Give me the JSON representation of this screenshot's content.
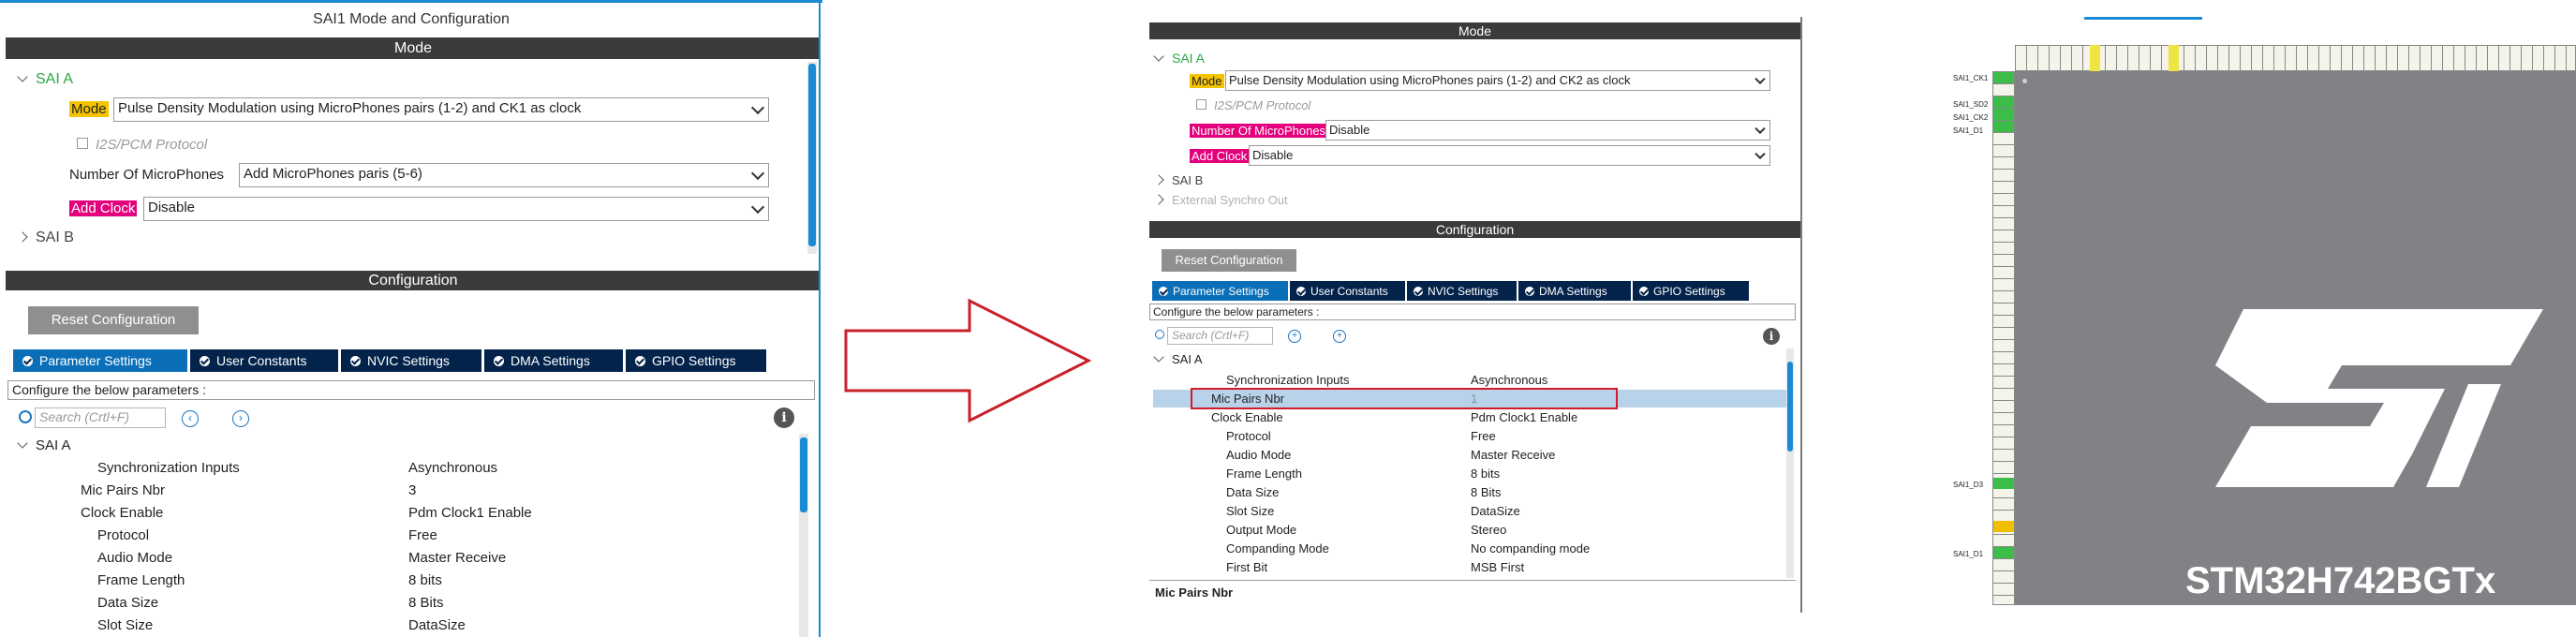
{
  "left": {
    "title": "SAI1 Mode and Configuration",
    "mode_header": "Mode",
    "sai_a_label": "SAI A",
    "mode_label": "Mode",
    "mode_value": "Pulse Density Modulation using MicroPhones pairs (1-2) and CK1 as clock",
    "i2s_protocol": "I2S/PCM Protocol",
    "num_mic_label": "Number Of MicroPhones",
    "num_mic_value": "Add MicroPhones paris (5-6)",
    "add_clock_label": "Add Clock",
    "add_clock_value": "Disable",
    "sai_b_label": "SAI B",
    "config_header": "Configuration",
    "reset_button": "Reset Configuration",
    "tabs": [
      "Parameter Settings",
      "User Constants",
      "NVIC Settings",
      "DMA Settings",
      "GPIO Settings"
    ],
    "configure_text": "Configure the below parameters :",
    "search_placeholder": "Search (Crtl+F)",
    "tree_sai_a": "SAI A",
    "params": [
      {
        "name": "Synchronization Inputs",
        "value": "Asynchronous"
      },
      {
        "name": "Mic Pairs Nbr",
        "value": "3"
      },
      {
        "name": "Clock Enable",
        "value": "Pdm Clock1 Enable"
      },
      {
        "name": "Protocol",
        "value": "Free"
      },
      {
        "name": "Audio Mode",
        "value": "Master Receive"
      },
      {
        "name": "Frame Length",
        "value": "8 bits"
      },
      {
        "name": "Data Size",
        "value": "8 Bits"
      },
      {
        "name": "Slot Size",
        "value": "DataSize"
      }
    ]
  },
  "mid": {
    "mode_header": "Mode",
    "sai_a_label": "SAI A",
    "mode_label": "Mode",
    "mode_value": "Pulse Density Modulation using MicroPhones pairs (1-2) and CK2 as clock",
    "i2s_protocol": "I2S/PCM Protocol",
    "num_mic_label": "Number Of MicroPhones",
    "num_mic_value": "Disable",
    "add_clock_label": "Add Clock",
    "add_clock_value": "Disable",
    "sai_b_label": "SAI B",
    "ext_sync_label": "External Synchro Out",
    "config_header": "Configuration",
    "reset_button": "Reset Configuration",
    "tabs": [
      "Parameter Settings",
      "User Constants",
      "NVIC Settings",
      "DMA Settings",
      "GPIO Settings"
    ],
    "configure_text": "Configure the below parameters :",
    "search_placeholder": "Search (Crtl+F)",
    "tree_sai_a": "SAI A",
    "params": [
      {
        "name": "Synchronization Inputs",
        "value": "Asynchronous"
      },
      {
        "name": "Mic Pairs Nbr",
        "value": "1"
      },
      {
        "name": "Clock Enable",
        "value": "Pdm Clock1 Enable"
      },
      {
        "name": "Protocol",
        "value": "Free"
      },
      {
        "name": "Audio Mode",
        "value": "Master Receive"
      },
      {
        "name": "Frame Length",
        "value": "8 bits"
      },
      {
        "name": "Data Size",
        "value": "8 Bits"
      },
      {
        "name": "Slot Size",
        "value": "DataSize"
      },
      {
        "name": "Output Mode",
        "value": "Stereo"
      },
      {
        "name": "Companding Mode",
        "value": "No companding mode"
      },
      {
        "name": "First Bit",
        "value": "MSB First"
      }
    ],
    "description_title": "Mic Pairs Nbr"
  },
  "chip": {
    "name": "STM32H742BGTx",
    "left_labels": [
      "SAI1_CK1",
      "SAI1_SD2",
      "SAI1_CK2",
      "SAI1_D1",
      "SAI1_D3",
      "SAI1_D1"
    ]
  },
  "colors": {
    "header_dark": "#3b3b3b",
    "tab_dark": "#03234b",
    "tab_active": "#0a6fb8",
    "mode_yellow": "#f5c400",
    "pink": "#e4007c",
    "green_sai": "#27a844",
    "highlight_red": "#d11a2a",
    "selected_row": "#b8d2ea",
    "chip_grey": "#808285"
  }
}
